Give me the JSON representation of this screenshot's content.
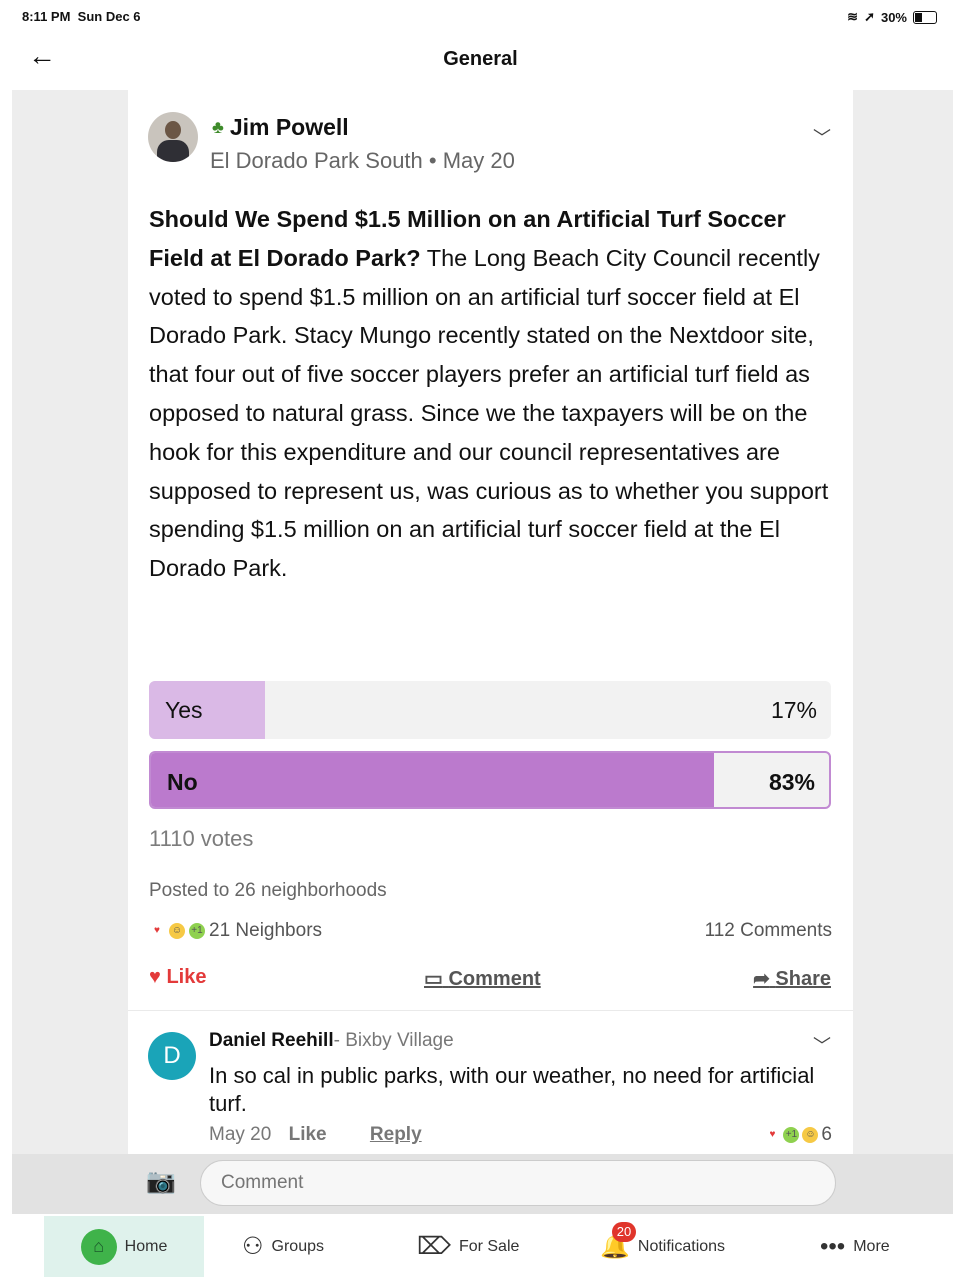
{
  "status_bar": {
    "time": "8:11 PM",
    "date": "Sun Dec 6",
    "battery": "30%"
  },
  "header": {
    "title": "General"
  },
  "post": {
    "author": "Jim Powell",
    "neighborhood": "El Dorado Park South",
    "separator": "•",
    "date": "May 20",
    "headline": "Should We Spend $1.5 Million on an Artificial Turf Soccer Field at El Dorado Park?",
    "body": "The Long Beach City Council recently voted to spend $1.5 million on an artificial turf soccer field at El Dorado Park. Stacy Mungo  recently stated on the Nextdoor site, that four out of five soccer players prefer an artificial turf field as opposed to natural grass.  Since we the taxpayers will be on the hook for this expenditure and our council representatives are supposed to represent  us, was curious as to whether you support spending $1.5 million on an artificial turf soccer field at the El Dorado Park.",
    "poll": {
      "options": [
        {
          "label": "Yes",
          "percent": "17%",
          "fraction": 0.17
        },
        {
          "label": "No",
          "percent": "83%",
          "fraction": 0.83
        }
      ],
      "votes": "1110 votes"
    },
    "posted_to": "Posted to 26 neighborhoods",
    "reactions": "21 Neighbors",
    "comment_count": "112 Comments",
    "actions": {
      "like": "Like",
      "comment": "Comment",
      "share": "Share"
    }
  },
  "comment": {
    "avatar_letter": "D",
    "author": "Daniel Reehill",
    "location": "- Bixby Village",
    "text": "In so cal in public parks, with our weather, no need for artificial turf.",
    "date": "May 20",
    "like": "Like",
    "reply": "Reply",
    "reactions": "6"
  },
  "composer": {
    "placeholder": "Comment"
  },
  "tabs": {
    "home": "Home",
    "groups": "Groups",
    "for_sale": "For Sale",
    "notifications": "Notifications",
    "notifications_badge": "20",
    "more": "More"
  },
  "colors": {
    "accent_purple": "#bb7acd",
    "like_red": "#e33a3a",
    "home_green": "#3fb34a"
  },
  "icons": [
    "back-arrow-icon",
    "tree-icon",
    "chevron-down-icon",
    "heart-icon",
    "comment-bubble-icon",
    "share-icon",
    "camera-icon",
    "home-icon",
    "groups-icon",
    "tag-icon",
    "bell-icon",
    "more-dots-icon"
  ]
}
